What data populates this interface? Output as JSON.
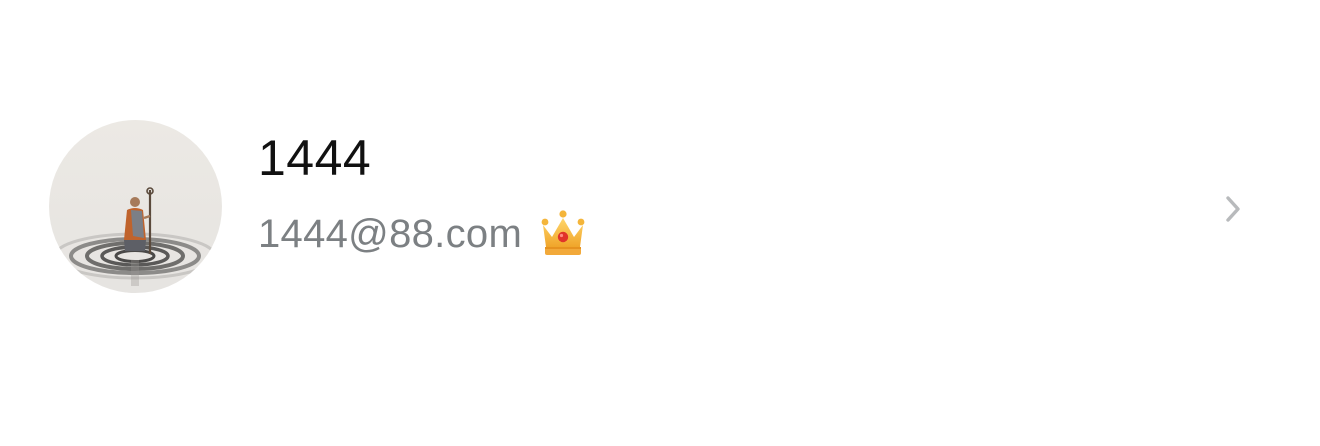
{
  "profile": {
    "username": "1444",
    "email": "1444@88.com",
    "badge_icon": "crown-icon",
    "arrow_icon": "chevron-right-icon"
  },
  "colors": {
    "background": "#ffffff",
    "username": "#111111",
    "email": "#7c8083",
    "chevron": "#b8babc",
    "crown_gold": "#f5b73b",
    "crown_jewel": "#e0342a"
  }
}
